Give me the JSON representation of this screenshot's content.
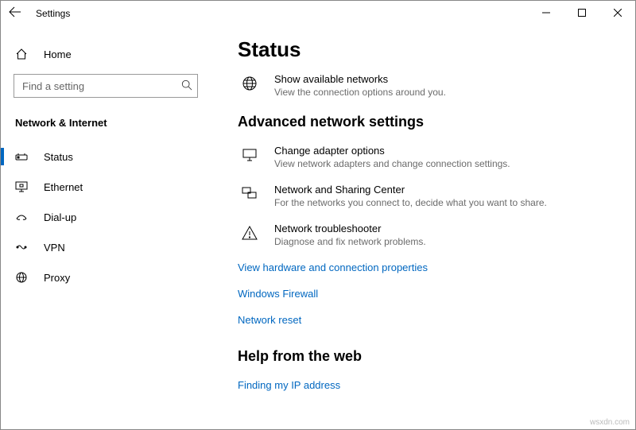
{
  "window": {
    "title": "Settings"
  },
  "sidebar": {
    "home_label": "Home",
    "search_placeholder": "Find a setting",
    "category_title": "Network & Internet",
    "items": [
      {
        "label": "Status",
        "icon": "status-icon",
        "selected": true
      },
      {
        "label": "Ethernet",
        "icon": "ethernet-icon",
        "selected": false
      },
      {
        "label": "Dial-up",
        "icon": "dialup-icon",
        "selected": false
      },
      {
        "label": "VPN",
        "icon": "vpn-icon",
        "selected": false
      },
      {
        "label": "Proxy",
        "icon": "proxy-icon",
        "selected": false
      }
    ]
  },
  "content": {
    "page_title": "Status",
    "tile_show_networks": {
      "label": "Show available networks",
      "desc": "View the connection options around you."
    },
    "section_advanced": "Advanced network settings",
    "tile_adapter": {
      "label": "Change adapter options",
      "desc": "View network adapters and change connection settings."
    },
    "tile_sharing": {
      "label": "Network and Sharing Center",
      "desc": "For the networks you connect to, decide what you want to share."
    },
    "tile_troubleshoot": {
      "label": "Network troubleshooter",
      "desc": "Diagnose and fix network problems."
    },
    "link_hw": "View hardware and connection properties",
    "link_firewall": "Windows Firewall",
    "link_reset": "Network reset",
    "section_help": "Help from the web",
    "link_ip": "Finding my IP address"
  },
  "watermark": "wsxdn.com"
}
